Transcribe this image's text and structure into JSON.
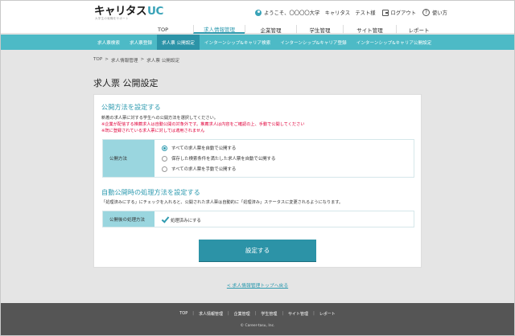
{
  "header": {
    "logo_main": "キャリタス",
    "logo_accent": "UC",
    "logo_sub": "大学生の就職をサポート",
    "welcome": "ようこそ、〇〇〇〇大学　キャリタス　テスト様",
    "logout": "ログアウト",
    "help": "使い方"
  },
  "main_nav": [
    {
      "label": "TOP"
    },
    {
      "label": "求人情報管理"
    },
    {
      "label": "企業管理"
    },
    {
      "label": "学生管理"
    },
    {
      "label": "サイト管理"
    },
    {
      "label": "レポート"
    }
  ],
  "sub_nav": [
    {
      "label": "求人票検索"
    },
    {
      "label": "求人票登録"
    },
    {
      "label": "求人票 公開設定"
    },
    {
      "label": "インターンシップ&キャリア検索"
    },
    {
      "label": "インターンシップ&キャリア登録"
    },
    {
      "label": "インターンシップ&キャリア公開設定"
    }
  ],
  "breadcrumb": [
    "TOP",
    "求人情報管理",
    "求人票 公開設定"
  ],
  "breadcrumb_sep": ">",
  "page_title": "求人票 公開設定",
  "section1": {
    "title": "公開方法を設定する",
    "desc": "新着の求人票に対する学生への公開方法を選択してください。",
    "note1": "※企業が配信する推薦求人は自動公開の対象外です。推薦求人は内容をご確認の上、手動で公開してください",
    "note2": "※既に登録されている求人票に対しては適用されません",
    "label": "公開方法",
    "options": [
      {
        "label": "すべての求人票を自動で公開する",
        "selected": true
      },
      {
        "label": "保存した検索条件を満たした求人票を自動で公開する",
        "selected": false
      },
      {
        "label": "すべての求人票を手動で公開する",
        "selected": false
      }
    ]
  },
  "section2": {
    "title": "自動公開時の処理方法を設定する",
    "desc": "「処理済みにする」にチェックを入れると、公開された求人票は自動的に「処理済み」ステータスに変更されるようになります。",
    "label": "公開後の処理方法",
    "checkbox_label": "処理済みにする",
    "checked": true
  },
  "submit_label": "設定する",
  "back_link": "< 求人情報管理トップへ戻る",
  "footer": {
    "nav": [
      "TOP",
      "求人情報管理",
      "企業管理",
      "学生管理",
      "サイト管理",
      "レポート"
    ],
    "copyright": "© Career-tasu, Inc."
  },
  "colors": {
    "accent": "#2f9bb0",
    "subnav_bg": "#4dbac6",
    "subnav_active": "#2c93a7",
    "label_bg": "#9ad6df",
    "warning": "#e0003a",
    "footer_bg": "#555555"
  }
}
